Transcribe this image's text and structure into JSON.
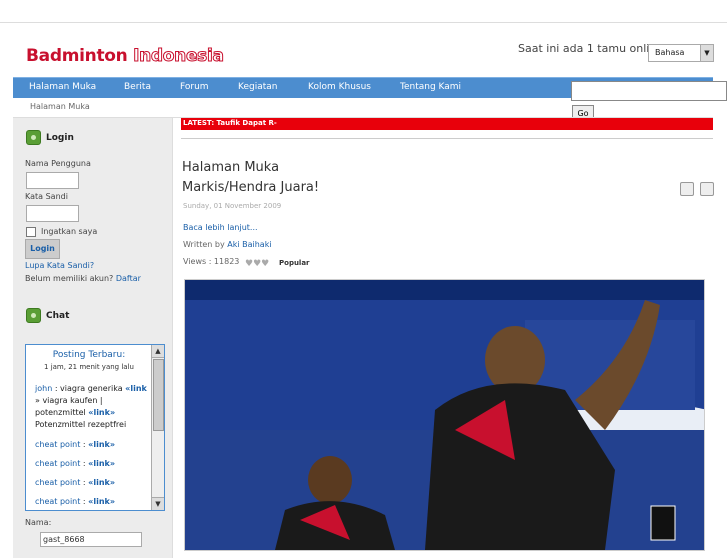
{
  "site": {
    "logo_word1": "Badminton",
    "logo_word2": "Indonesia",
    "online_text": "Saat ini ada 1 tamu online",
    "language": "Bahasa"
  },
  "nav": {
    "items": [
      "Halaman Muka",
      "Berita",
      "Forum",
      "Kegiatan",
      "Kolom Khusus",
      "Tentang Kami"
    ]
  },
  "search": {
    "value": "",
    "go_label": "Go"
  },
  "breadcrumb": "Halaman Muka",
  "login": {
    "title": "Login",
    "username_label": "Nama Pengguna",
    "password_label": "Kata Sandi",
    "remember_label": "Ingatkan saya",
    "button": "Login",
    "forgot": "Lupa Kata Sandi?",
    "no_account": "Belum memiliki akun?",
    "register": "Daftar"
  },
  "chat": {
    "title": "Chat",
    "latest_header": "Posting Terbaru:",
    "latest_time": "1 jam, 21 menit yang lalu",
    "messages": [
      {
        "user": "john",
        "text": ": viagra generika",
        "link": "«link",
        "extra": "» viagra kaufen | potenzmittel",
        "link2": "«link»",
        "extra2": "Potenzmittel rezeptfrei"
      },
      {
        "user": "cheat point",
        "text": ":",
        "link": "«link»"
      },
      {
        "user": "cheat point",
        "text": ":",
        "link": "«link»"
      },
      {
        "user": "cheat point",
        "text": ":",
        "link": "«link»"
      },
      {
        "user": "cheat point",
        "text": ":",
        "link": "«link»"
      }
    ],
    "name_label": "Nama:",
    "name_value": "gast_8668"
  },
  "latest_bar": "LATEST: Taufik Dapat R-",
  "article": {
    "section": "Halaman Muka",
    "title": "Markis/Hendra Juara!",
    "date": "Sunday, 01 November 2009",
    "read_more": "Baca lebih lanjut...",
    "written_by": "Written by",
    "author": "Aki Baihaki",
    "views": "Views : 11823",
    "popular": "Popular"
  },
  "colors": {
    "nav": "#4c8dcf",
    "latest": "#e8000b",
    "link": "#1a5fa8"
  }
}
